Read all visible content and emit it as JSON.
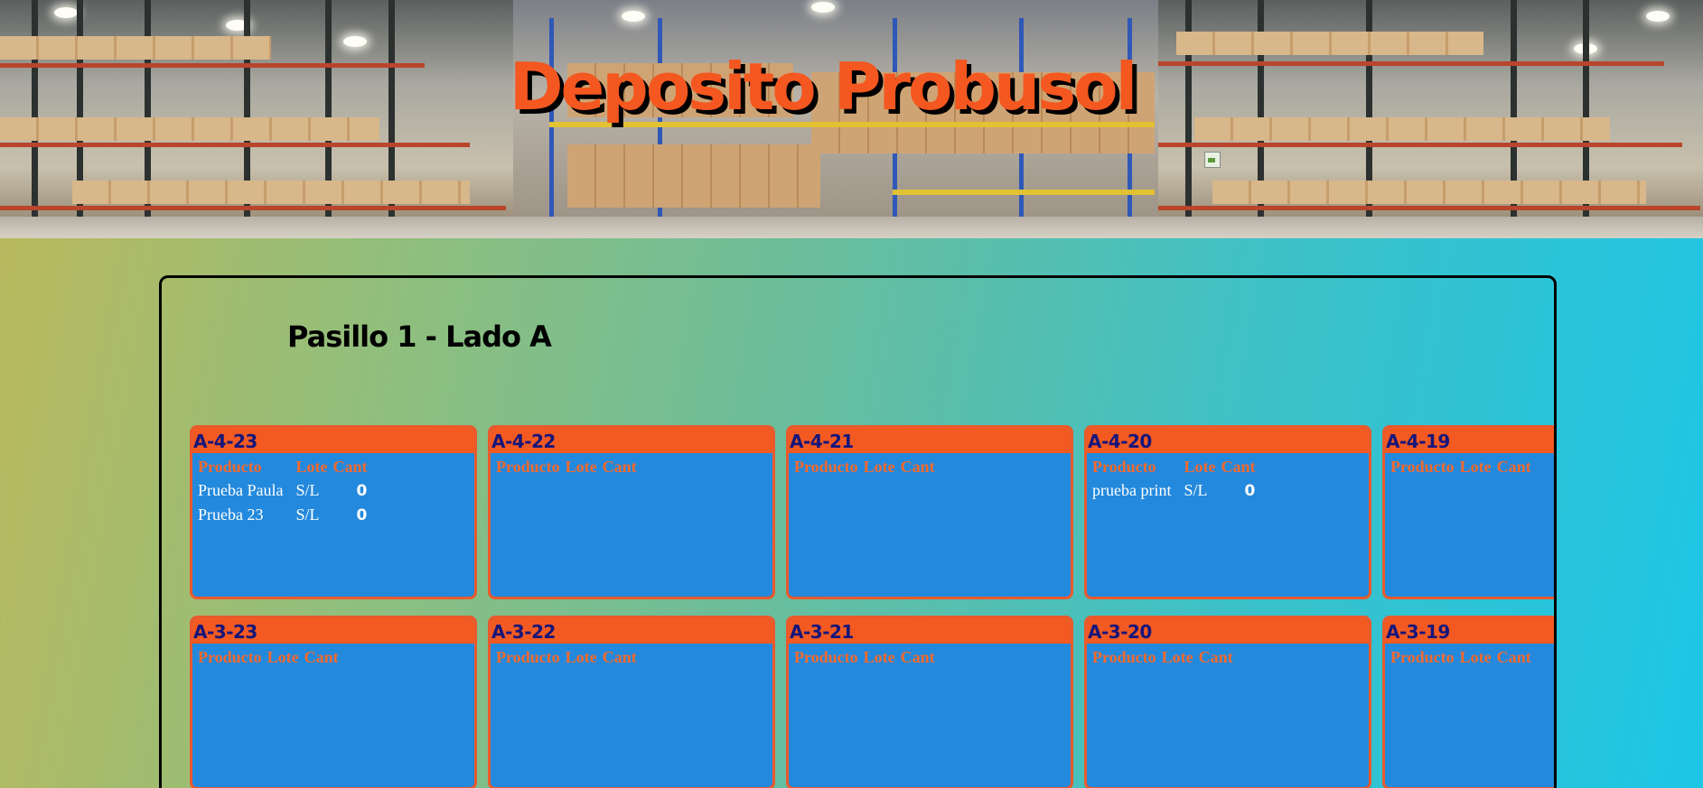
{
  "header": {
    "title": "Deposito Probusol"
  },
  "section": {
    "title": "Pasillo 1 - Lado A"
  },
  "table_columns": {
    "producto": "Producto",
    "lote": "Lote",
    "cant": "Cant"
  },
  "rows_of_cells": [
    [
      {
        "code": "A-4-23",
        "items": [
          {
            "producto": "Prueba Paula",
            "lote": "S/L",
            "cant": "0"
          },
          {
            "producto": "Prueba 23",
            "lote": "S/L",
            "cant": "0"
          }
        ]
      },
      {
        "code": "A-4-22",
        "items": []
      },
      {
        "code": "A-4-21",
        "items": []
      },
      {
        "code": "A-4-20",
        "items": [
          {
            "producto": "prueba print",
            "lote": "S/L",
            "cant": "0"
          }
        ]
      },
      {
        "code": "A-4-19",
        "items": []
      }
    ],
    [
      {
        "code": "A-3-23",
        "items": []
      },
      {
        "code": "A-3-22",
        "items": []
      },
      {
        "code": "A-3-21",
        "items": []
      },
      {
        "code": "A-3-20",
        "items": []
      },
      {
        "code": "A-3-19",
        "items": []
      }
    ]
  ],
  "colors": {
    "cell_background": "#2389dd",
    "cell_header": "#f25a22",
    "header_text": "#16167a",
    "title_orange": "#f4571f"
  }
}
